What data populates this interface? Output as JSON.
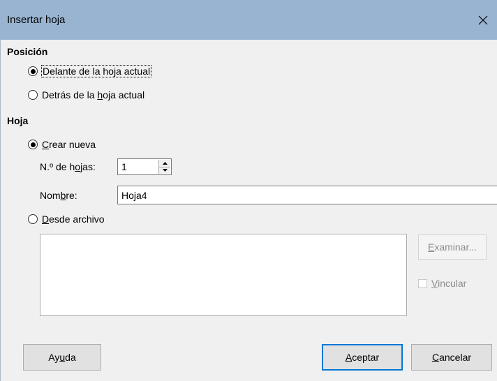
{
  "dialog": {
    "title": "Insertar hoja",
    "close_icon": "close-icon"
  },
  "position": {
    "heading": "Posición",
    "before_label": "Delante de la hoja actual",
    "before_selected": true,
    "after_label_pre": "Detrás de la ",
    "after_label_u": "h",
    "after_label_post": "oja actual",
    "after_selected": false
  },
  "sheet": {
    "heading": "Hoja",
    "new_label_u": "C",
    "new_label_rest": "rear nueva",
    "new_selected": true,
    "count_label_pre": "N.º de h",
    "count_label_u": "o",
    "count_label_post": "jas:",
    "count_value": "1",
    "name_label_pre": "Nom",
    "name_label_u": "b",
    "name_label_post": "re:",
    "name_value": "Hoja4",
    "from_file_label_u": "D",
    "from_file_label_rest": "esde archivo",
    "from_file_selected": false,
    "browse_label_u": "E",
    "browse_label_rest": "xaminar...",
    "link_label_u": "V",
    "link_label_rest": "incular",
    "link_checked": false
  },
  "buttons": {
    "help_pre": "Ay",
    "help_u": "u",
    "help_post": "da",
    "ok_u": "A",
    "ok_rest": "ceptar",
    "cancel_u": "C",
    "cancel_rest": "ancelar"
  },
  "colors": {
    "titlebar": "#99b4d1",
    "background": "#f0f0f0",
    "default_button_border": "#0078d7"
  }
}
